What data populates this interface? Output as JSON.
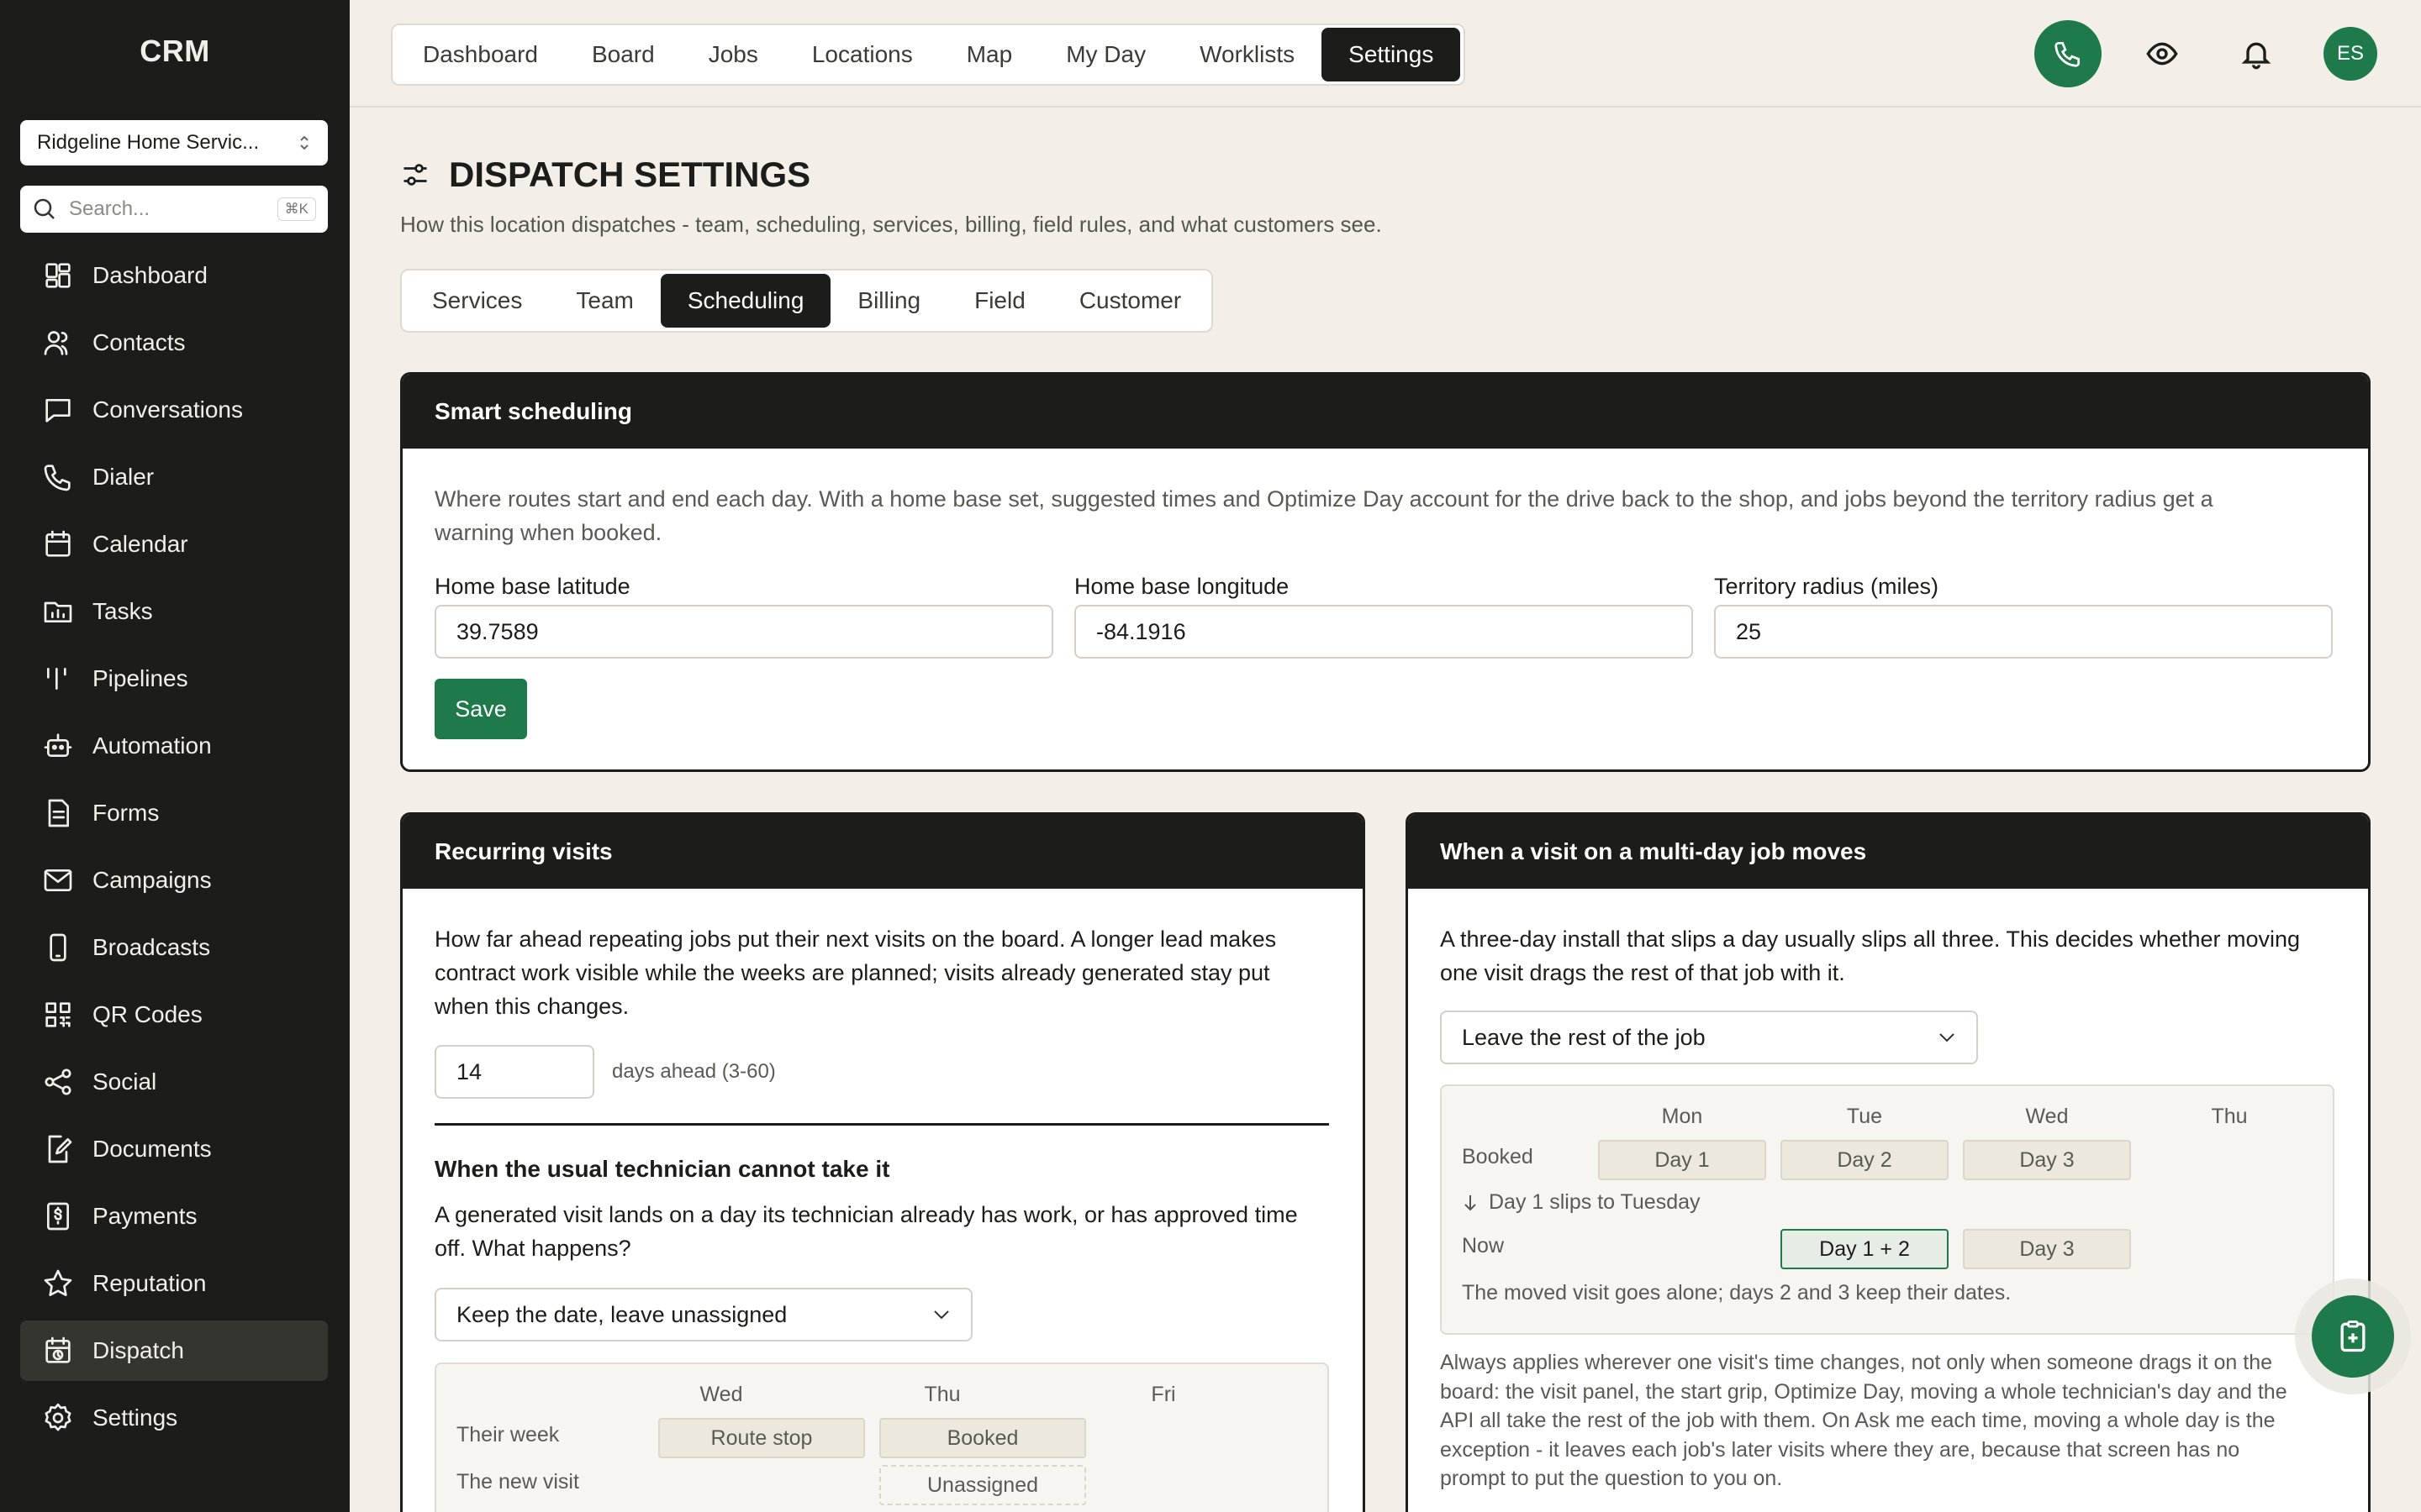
{
  "sidebar": {
    "logo": "CRM",
    "location": "Ridgeline Home Servic...",
    "search_placeholder": "Search...",
    "search_kbd": "⌘K",
    "items": [
      {
        "label": "Dashboard",
        "icon": "grid-icon"
      },
      {
        "label": "Contacts",
        "icon": "users-icon"
      },
      {
        "label": "Conversations",
        "icon": "chat-icon"
      },
      {
        "label": "Dialer",
        "icon": "phone-icon"
      },
      {
        "label": "Calendar",
        "icon": "calendar-icon"
      },
      {
        "label": "Tasks",
        "icon": "folder-icon"
      },
      {
        "label": "Pipelines",
        "icon": "pipeline-icon"
      },
      {
        "label": "Automation",
        "icon": "robot-icon"
      },
      {
        "label": "Forms",
        "icon": "document-icon"
      },
      {
        "label": "Campaigns",
        "icon": "mail-icon"
      },
      {
        "label": "Broadcasts",
        "icon": "mobile-icon"
      },
      {
        "label": "QR Codes",
        "icon": "qr-icon"
      },
      {
        "label": "Social",
        "icon": "share-icon"
      },
      {
        "label": "Documents",
        "icon": "edit-document-icon"
      },
      {
        "label": "Payments",
        "icon": "dollar-icon"
      },
      {
        "label": "Reputation",
        "icon": "star-icon"
      },
      {
        "label": "Dispatch",
        "icon": "calendar-clock-icon",
        "active": true
      },
      {
        "label": "Settings",
        "icon": "gear-icon"
      }
    ]
  },
  "topnav": {
    "tabs": [
      "Dashboard",
      "Board",
      "Jobs",
      "Locations",
      "Map",
      "My Day",
      "Worklists",
      "Settings"
    ],
    "active": "Settings",
    "avatar": "ES"
  },
  "page": {
    "title": "DISPATCH SETTINGS",
    "subtitle": "How this location dispatches - team, scheduling, services, billing, field rules, and what customers see.",
    "tabs": [
      "Services",
      "Team",
      "Scheduling",
      "Billing",
      "Field",
      "Customer"
    ],
    "active_tab": "Scheduling"
  },
  "smart": {
    "title": "Smart scheduling",
    "desc_line1": "Where routes start and end each day. With a home base set, suggested times and Optimize Day account for the drive back to the shop, and jobs beyond the territory radius get a",
    "desc_line2": "warning when booked.",
    "lat_label": "Home base latitude",
    "lat_value": "39.7589",
    "lng_label": "Home base longitude",
    "lng_value": "-84.1916",
    "radius_label": "Territory radius (miles)",
    "radius_value": "25",
    "save": "Save"
  },
  "recurring": {
    "title": "Recurring visits",
    "desc_line1": "How far ahead repeating jobs put their next visits on the board. A longer lead makes",
    "desc_line2": "contract work visible while the weeks are planned; visits already generated stay put",
    "desc_line3": "when this changes.",
    "days_value": "14",
    "days_hint": "days ahead (3-60)",
    "sub_title": "When the usual technician cannot take it",
    "sub_desc_line1": "A generated visit lands on a day its technician already has work, or has approved time",
    "sub_desc_line2": "off. What happens?",
    "select_value": "Keep the date, leave unassigned",
    "demo": {
      "days": [
        "Wed",
        "Thu",
        "Fri"
      ],
      "row1_label": "Their week",
      "row1_wed": "Route stop",
      "row1_thu": "Booked",
      "row2_label": "The new visit",
      "row2_thu": "Unassigned"
    }
  },
  "multiday": {
    "title": "When a visit on a multi-day job moves",
    "desc_line1": "A three-day install that slips a day usually slips all three. This decides whether moving",
    "desc_line2": "one visit drags the rest of that job with it.",
    "select_value": "Leave the rest of the job",
    "demo": {
      "days": [
        "Mon",
        "Tue",
        "Wed",
        "Thu"
      ],
      "booked_label": "Booked",
      "booked": [
        "Day 1",
        "Day 2",
        "Day 3"
      ],
      "slip_note": "Day 1 slips to Tuesday",
      "now_label": "Now",
      "now_tue": "Day 1 + 2",
      "now_wed": "Day 3",
      "result": "The moved visit goes alone; days 2 and 3 keep their dates."
    },
    "note_line1": "Always applies wherever one visit's time changes, not only when someone drags it on the",
    "note_line2": "board: the visit panel, the start grip, Optimize Day, moving a whole technician's day and the",
    "note_line3": "API all take the rest of the job with them. On Ask me each time, moving a whole day is the",
    "note_line4": "exception - it leaves each job's later visits where they are, because that screen has no",
    "note_line5": "prompt to put the question to you on."
  },
  "colors": {
    "brand_green": "#1f7a4b",
    "sidebar_bg": "#1c1d1b",
    "page_bg": "#f3efe8"
  }
}
